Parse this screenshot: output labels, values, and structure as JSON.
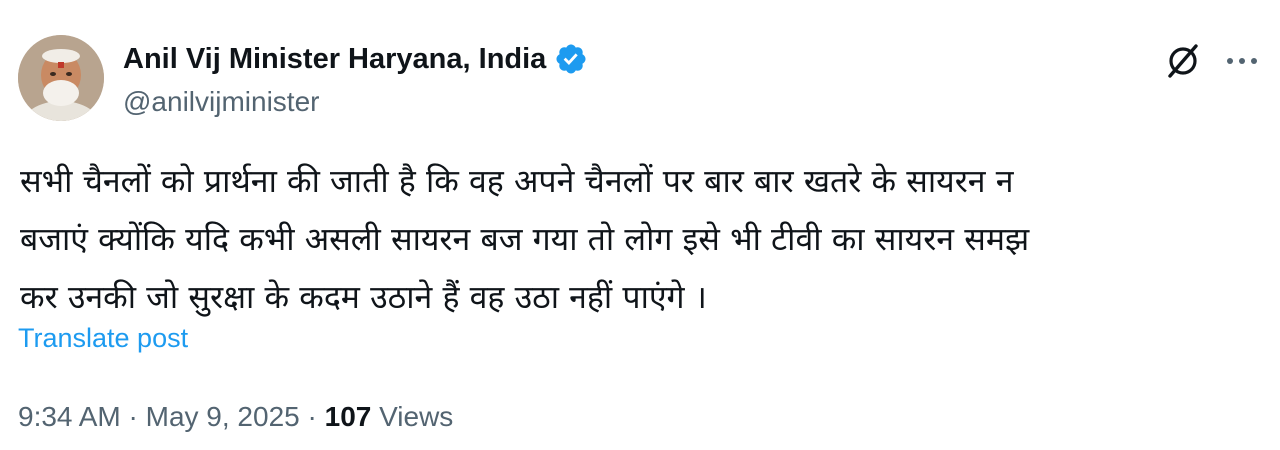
{
  "author": {
    "display_name": "Anil Vij Minister Haryana, India",
    "handle": "@anilvijminister",
    "verified": true,
    "verified_color": "#1d9bf0",
    "avatar_icon": "profile-photo"
  },
  "header_actions": {
    "grok_icon": "grok-icon",
    "more_icon": "more-options-icon"
  },
  "post": {
    "lines": [
      "सभी चैनलों को प्रार्थना की जाती है कि वह अपने चैनलों पर बार बार खतरे के सायरन न",
      "बजाएं क्योंकि यदि कभी असली सायरन बज गया तो लोग इसे भी टीवी का सायरन समझ",
      "कर उनकी जो सुरक्षा  के कदम उठाने हैं वह उठा नहीं पाएंगे ।"
    ],
    "translate_label": "Translate post"
  },
  "meta": {
    "time": "9:34 AM",
    "date": "May 9, 2025",
    "separator": "·",
    "views_count": "107",
    "views_label": "Views"
  },
  "colors": {
    "text_primary": "#0f1419",
    "text_secondary": "#536471",
    "link": "#1d9bf0"
  }
}
